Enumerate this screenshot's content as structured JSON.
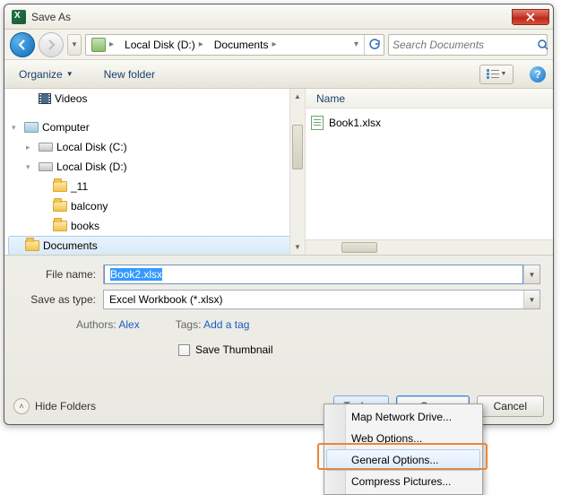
{
  "window": {
    "title": "Save As"
  },
  "breadcrumb": {
    "segments": [
      "Local Disk (D:)",
      "Documents"
    ],
    "refresh_icon": "refresh-icon"
  },
  "search": {
    "placeholder": "Search Documents"
  },
  "toolbar": {
    "organize": "Organize",
    "newfolder": "New folder"
  },
  "tree": {
    "videos": "Videos",
    "computer": "Computer",
    "driveC": "Local Disk (C:)",
    "driveD": "Local Disk (D:)",
    "f11": "_11",
    "balcony": "balcony",
    "books": "books",
    "documents": "Documents"
  },
  "list": {
    "header_name": "Name",
    "file1": "Book1.xlsx"
  },
  "form": {
    "filename_label": "File name:",
    "filename_value": "Book2.xlsx",
    "savetype_label": "Save as type:",
    "savetype_value": "Excel Workbook (*.xlsx)",
    "authors_label": "Authors:",
    "authors_value": "Alex",
    "tags_label": "Tags:",
    "tags_value": "Add a tag",
    "save_thumbnail": "Save Thumbnail"
  },
  "footer": {
    "hide_folders": "Hide Folders",
    "tools": "Tools",
    "save": "Save",
    "cancel": "Cancel"
  },
  "menu": {
    "map_drive": "Map Network Drive...",
    "web_options": "Web Options...",
    "general_options": "General Options...",
    "compress": "Compress Pictures..."
  }
}
